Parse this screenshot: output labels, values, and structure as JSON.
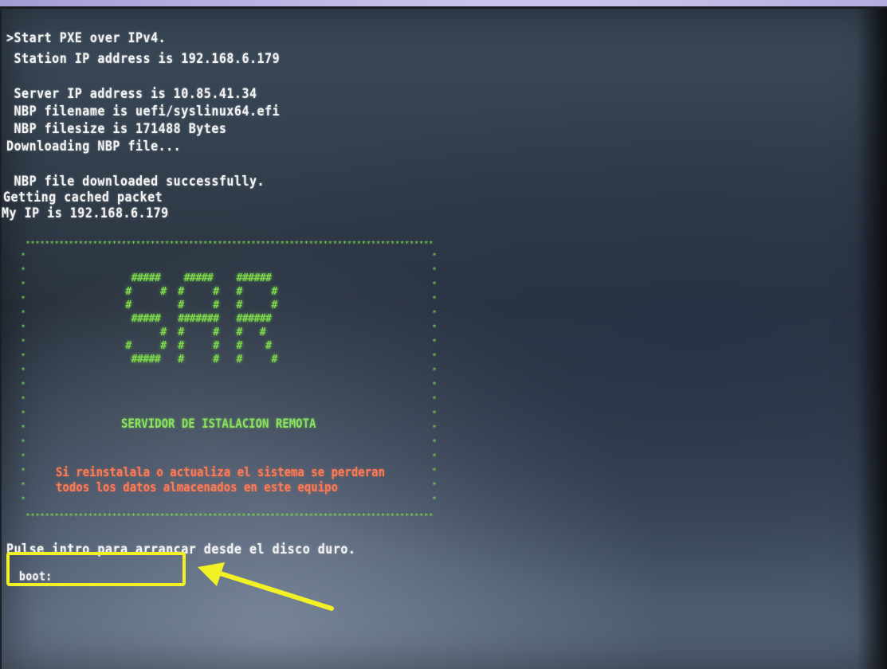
{
  "terminal": {
    "lines": [
      ">Start PXE over IPv4.",
      " Station IP address is 192.168.6.179",
      "",
      " Server IP address is 10.85.41.34",
      " NBP filename is uefi/syslinux64.efi",
      " NBP filesize is 171488 Bytes",
      "Downloading NBP file...",
      "",
      " NBP file downloaded successfully.",
      "Getting cached packet",
      "My IP is 192.168.6.179"
    ],
    "prompt_hint": "Pulse intro para arrancar desde el disco duro.",
    "boot_prompt": "boot:"
  },
  "banner": {
    "ascii_art": "  #####    #####    ######\n #     #  #     #   #     #\n #        #     #   #     #\n  #####   #######   ######\n       #  #     #   #   #\n #     #  #     #   #    #\n  #####   #     #   #     #",
    "subtitle": "SERVIDOR DE ISTALACION REMOTA",
    "warning_line1": "Si reinstalala o actualiza el sistema se perderan",
    "warning_line2": "todos los datos almacenados en este equipo",
    "border_char": "*"
  },
  "colors": {
    "terminal_text": "#f2f2f2",
    "banner_green": "#7ed84a",
    "warning_red": "#ff7a55",
    "highlight_yellow": "#f1f126"
  },
  "annotations": {
    "highlight": "boot-prompt-highlight",
    "arrow": "arrow-icon"
  }
}
